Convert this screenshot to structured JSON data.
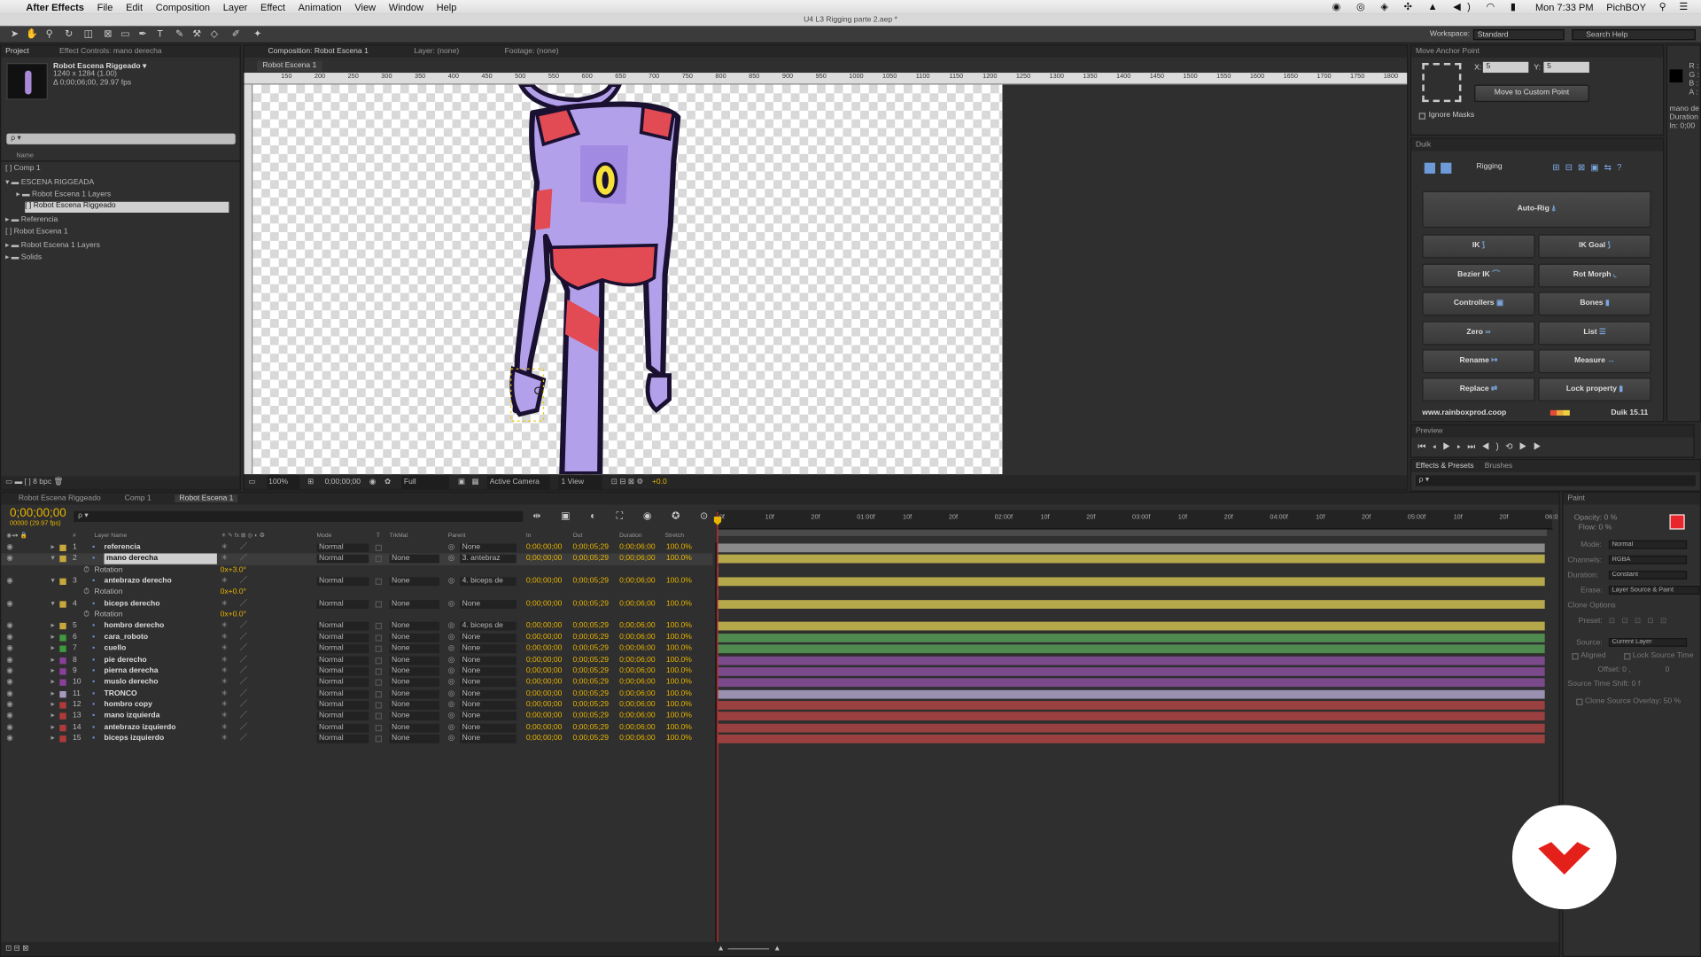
{
  "menubar": {
    "app": "After Effects",
    "items": [
      "File",
      "Edit",
      "Composition",
      "Layer",
      "Effect",
      "Animation",
      "View",
      "Window",
      "Help"
    ],
    "clock": "Mon 7:33 PM",
    "user": "PichBOY"
  },
  "window_title": "U4 L3 Rigging parte 2.aep *",
  "workspace": {
    "label": "Workspace:",
    "value": "Standard",
    "search": "Search Help"
  },
  "project": {
    "tabs": [
      "Project",
      "Effect Controls: mano derecha"
    ],
    "item_name": "Robot Escena Riggeado ▾",
    "item_size": "1240 x 1284 (1.00)",
    "item_dur": "Δ 0;00;06;00, 29.97 fps",
    "search_placeholder": "ρ ▾",
    "col_name": "Name",
    "items": [
      "Comp 1",
      "ESCENA RIGGEADA",
      "Robot Escena 1 Layers",
      "Robot Escena Riggeado",
      "Referencia",
      "Robot Escena 1",
      "Robot Escena 1 Layers",
      "Solids"
    ],
    "bpc": "8 bpc"
  },
  "viewer": {
    "tabs": [
      "Composition: Robot Escena 1",
      "Layer: (none)",
      "Footage: (none)"
    ],
    "crumb": "Robot Escena 1",
    "ruler": [
      "150",
      "200",
      "250",
      "300",
      "350",
      "400",
      "450",
      "500",
      "550",
      "600",
      "650",
      "700",
      "750",
      "800",
      "850",
      "900",
      "950",
      "1000",
      "1050",
      "1100",
      "1150",
      "1200",
      "1250",
      "1300",
      "1350",
      "1400",
      "1450",
      "1500",
      "1550",
      "1600",
      "1650",
      "1700",
      "1750",
      "1800"
    ],
    "zoom": "100%",
    "time": "0;00;00;00",
    "res": "Full",
    "camera": "Active Camera",
    "view": "1 View",
    "exposure": "+0.0"
  },
  "anchor": {
    "tab": "Move Anchor Point",
    "x_label": "X:",
    "x": "5",
    "y_label": "Y:",
    "y": "5",
    "move_btn": "Move to Custom Point",
    "ignore": "Ignore Masks"
  },
  "info": {
    "r": "R :",
    "g": "G :",
    "b": "B :",
    "a": "A :",
    "l1": "mano de",
    "l2": "Duration",
    "l3": "In: 0;00"
  },
  "duik": {
    "tab": "Duik",
    "mode": "Rigging",
    "autorig": "Auto-Rig",
    "buttons": [
      "IK",
      "IK Goal",
      "Bezier IK",
      "Rot Morph",
      "Controllers",
      "Bones",
      "Zero",
      "List",
      "Rename",
      "Measure",
      "Replace",
      "Lock property"
    ],
    "site": "www.rainboxprod.coop",
    "version": "Duik 15.11"
  },
  "preview": {
    "tab": "Preview"
  },
  "effects": {
    "tabs": [
      "Effects & Presets",
      "Brushes"
    ],
    "search": "ρ ▾"
  },
  "timeline": {
    "tabs": [
      "Robot Escena Riggeado",
      "Comp 1",
      "Robot Escena 1"
    ],
    "time": "0;00;00;00",
    "fps": "00000 (29.97 fps)",
    "search": "ρ ▾",
    "cols": [
      "#",
      "Layer Name",
      "Mode",
      "T",
      "TrkMat",
      "Parent",
      "In",
      "Out",
      "Duration",
      "Stretch"
    ],
    "ruler": [
      "0f",
      "10f",
      "20f",
      "01:00f",
      "10f",
      "20f",
      "02:00f",
      "10f",
      "20f",
      "03:00f",
      "10f",
      "20f",
      "04:00f",
      "10f",
      "20f",
      "05:00f",
      "10f",
      "20f",
      "06:0"
    ],
    "layers": [
      {
        "num": "1",
        "name": "referencia",
        "mode": "Normal",
        "trk": "",
        "parent": "None",
        "in": "0;00;00;00",
        "out": "0;00;05;29",
        "dur": "0;00;06;00",
        "str": "100.0%",
        "color": "#c8a83c",
        "bar": "#8a8a8a"
      },
      {
        "num": "2",
        "name": "mano derecha",
        "mode": "Normal",
        "trk": "None",
        "parent": "3. antebraz",
        "in": "0;00;00;00",
        "out": "0;00;05;29",
        "dur": "0;00;06;00",
        "str": "100.0%",
        "color": "#c8a83c",
        "bar": "#b5a84a",
        "sel": true
      },
      {
        "prop": "Rotation",
        "val": "0x+3.0°"
      },
      {
        "num": "3",
        "name": "antebrazo derecho",
        "mode": "Normal",
        "trk": "None",
        "parent": "4. biceps de",
        "in": "0;00;00;00",
        "out": "0;00;05;29",
        "dur": "0;00;06;00",
        "str": "100.0%",
        "color": "#c8a83c",
        "bar": "#b5a84a"
      },
      {
        "prop": "Rotation",
        "val": "0x+0.0°"
      },
      {
        "num": "4",
        "name": "biceps derecho",
        "mode": "Normal",
        "trk": "None",
        "parent": "None",
        "in": "0;00;00;00",
        "out": "0;00;05;29",
        "dur": "0;00;06;00",
        "str": "100.0%",
        "color": "#c8a83c",
        "bar": "#b5a84a"
      },
      {
        "prop": "Rotation",
        "val": "0x+0.0°"
      },
      {
        "num": "5",
        "name": "hombro derecho",
        "mode": "Normal",
        "trk": "None",
        "parent": "4. biceps de",
        "in": "0;00;00;00",
        "out": "0;00;05;29",
        "dur": "0;00;06;00",
        "str": "100.0%",
        "color": "#c8a83c",
        "bar": "#b5a84a"
      },
      {
        "num": "6",
        "name": "cara_roboto",
        "mode": "Normal",
        "trk": "None",
        "parent": "None",
        "in": "0;00;00;00",
        "out": "0;00;05;29",
        "dur": "0;00;06;00",
        "str": "100.0%",
        "color": "#3f9a3f",
        "bar": "#4f8a4f"
      },
      {
        "num": "7",
        "name": "cuello",
        "mode": "Normal",
        "trk": "None",
        "parent": "None",
        "in": "0;00;00;00",
        "out": "0;00;05;29",
        "dur": "0;00;06;00",
        "str": "100.0%",
        "color": "#3f9a3f",
        "bar": "#4f8a4f"
      },
      {
        "num": "8",
        "name": "pie derecho",
        "mode": "Normal",
        "trk": "None",
        "parent": "None",
        "in": "0;00;00;00",
        "out": "0;00;05;29",
        "dur": "0;00;06;00",
        "str": "100.0%",
        "color": "#8a3f9a",
        "bar": "#7a4a8a"
      },
      {
        "num": "9",
        "name": "pierna derecha",
        "mode": "Normal",
        "trk": "None",
        "parent": "None",
        "in": "0;00;00;00",
        "out": "0;00;05;29",
        "dur": "0;00;06;00",
        "str": "100.0%",
        "color": "#8a3f9a",
        "bar": "#7a4a8a"
      },
      {
        "num": "10",
        "name": "muslo derecho",
        "mode": "Normal",
        "trk": "None",
        "parent": "None",
        "in": "0;00;00;00",
        "out": "0;00;05;29",
        "dur": "0;00;06;00",
        "str": "100.0%",
        "color": "#8a3f9a",
        "bar": "#7a4a8a"
      },
      {
        "num": "11",
        "name": "TRONCO",
        "mode": "Normal",
        "trk": "None",
        "parent": "None",
        "in": "0;00;00;00",
        "out": "0;00;05;29",
        "dur": "0;00;06;00",
        "str": "100.0%",
        "color": "#a89ac0",
        "bar": "#9a90b0"
      },
      {
        "num": "12",
        "name": "hombro copy",
        "mode": "Normal",
        "trk": "None",
        "parent": "None",
        "in": "0;00;00;00",
        "out": "0;00;05;29",
        "dur": "0;00;06;00",
        "str": "100.0%",
        "color": "#b03a3a",
        "bar": "#9a4040"
      },
      {
        "num": "13",
        "name": "mano izquierda",
        "mode": "Normal",
        "trk": "None",
        "parent": "None",
        "in": "0;00;00;00",
        "out": "0;00;05;29",
        "dur": "0;00;06;00",
        "str": "100.0%",
        "color": "#b03a3a",
        "bar": "#9a4040"
      },
      {
        "num": "14",
        "name": "antebrazo izquierdo",
        "mode": "Normal",
        "trk": "None",
        "parent": "None",
        "in": "0;00;00;00",
        "out": "0;00;05;29",
        "dur": "0;00;06;00",
        "str": "100.0%",
        "color": "#b03a3a",
        "bar": "#9a4040"
      },
      {
        "num": "15",
        "name": "biceps izquierdo",
        "mode": "Normal",
        "trk": "None",
        "parent": "None",
        "in": "0;00;00;00",
        "out": "0;00;05;29",
        "dur": "0;00;06;00",
        "str": "100.0%",
        "color": "#b03a3a",
        "bar": "#9a4040"
      }
    ]
  },
  "paint": {
    "tab": "Paint",
    "opacity": "Opacity: 0 %",
    "flow": "Flow: 0 %",
    "mode": "Mode:",
    "mode_v": "Normal",
    "channels": "Channels:",
    "channels_v": "RGBA",
    "duration": "Duration:",
    "duration_v": "Constant",
    "erase": "Erase:",
    "erase_v": "Layer Source & Paint",
    "clone": "Clone Options",
    "preset": "Preset:",
    "source": "Source:",
    "source_v": "Current Layer",
    "aligned": "Aligned",
    "lock": "Lock Source Time",
    "offset": "Offset: 0 ,",
    "offset2": "0",
    "shift": "Source Time Shift: 0 f",
    "overlay": "Clone Source Overlay: 50 %",
    "fg": "#e8262b"
  }
}
